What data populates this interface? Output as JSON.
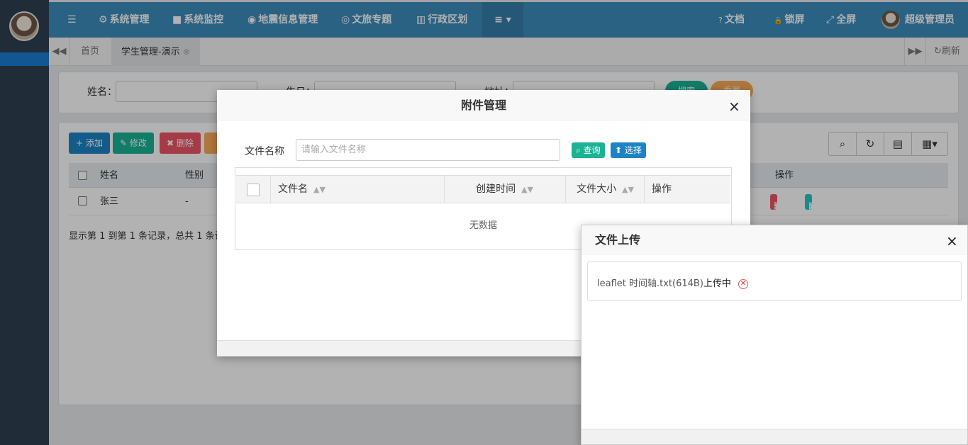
{
  "navbar": {
    "menu_icon": "bars-icon",
    "items": [
      {
        "icon": "⚙",
        "label": "系统管理"
      },
      {
        "icon": "■",
        "label": "系统监控"
      },
      {
        "icon": "◉",
        "label": "地震信息管理"
      },
      {
        "icon": "◎",
        "label": "文旅专题"
      },
      {
        "icon": "▥",
        "label": "行政区划"
      }
    ],
    "more_icon": "≡ ▾",
    "right": {
      "docs": {
        "icon": "?",
        "label": "文档"
      },
      "lock": {
        "icon": "🔒",
        "label": "锁屏"
      },
      "fullscreen": {
        "icon": "⤢",
        "label": "全屏"
      },
      "user": {
        "label": "超级管理员"
      }
    },
    "color": "#3c8dbc"
  },
  "tabs": {
    "home": "首页",
    "active": "学生管理-演示",
    "active_close": "⊗",
    "refresh": "刷新",
    "refresh_icon": "↻"
  },
  "search": {
    "name_label": "姓名：",
    "birthday_label": "生日：",
    "address_label": "地址：",
    "search_button": "搜索",
    "reset_button": "重置"
  },
  "toolbar": {
    "add": "添加",
    "edit": "修改",
    "delete": "删除",
    "add_icon": "+",
    "edit_icon": "✎",
    "delete_icon": "✖"
  },
  "table": {
    "columns": [
      "姓名",
      "性别",
      "操作"
    ],
    "rows": [
      {
        "name": "张三",
        "gender": "-",
        "actions": {
          "edit": "编辑",
          "delete": "删除",
          "attach": "附件"
        }
      }
    ],
    "pager": "显示第 1 到第 1 条记录，总共 1 条记"
  },
  "attachment_modal": {
    "title": "附件管理",
    "close": "×",
    "file_name_label": "文件名称",
    "file_name_placeholder": "请输入文件名称",
    "query_button": "查询",
    "select_button": "选择",
    "columns": [
      {
        "label": "文件名"
      },
      {
        "label": "创建时间"
      },
      {
        "label": "文件大小"
      },
      {
        "label": "操作"
      }
    ],
    "sort_icon": "▲▼",
    "empty_text": "无数据"
  },
  "upload_modal": {
    "title": "文件上传",
    "close": "×",
    "file_name": "leaflet 时间轴.txt(614B)",
    "status": "上传中",
    "cancel_icon": "✕"
  }
}
